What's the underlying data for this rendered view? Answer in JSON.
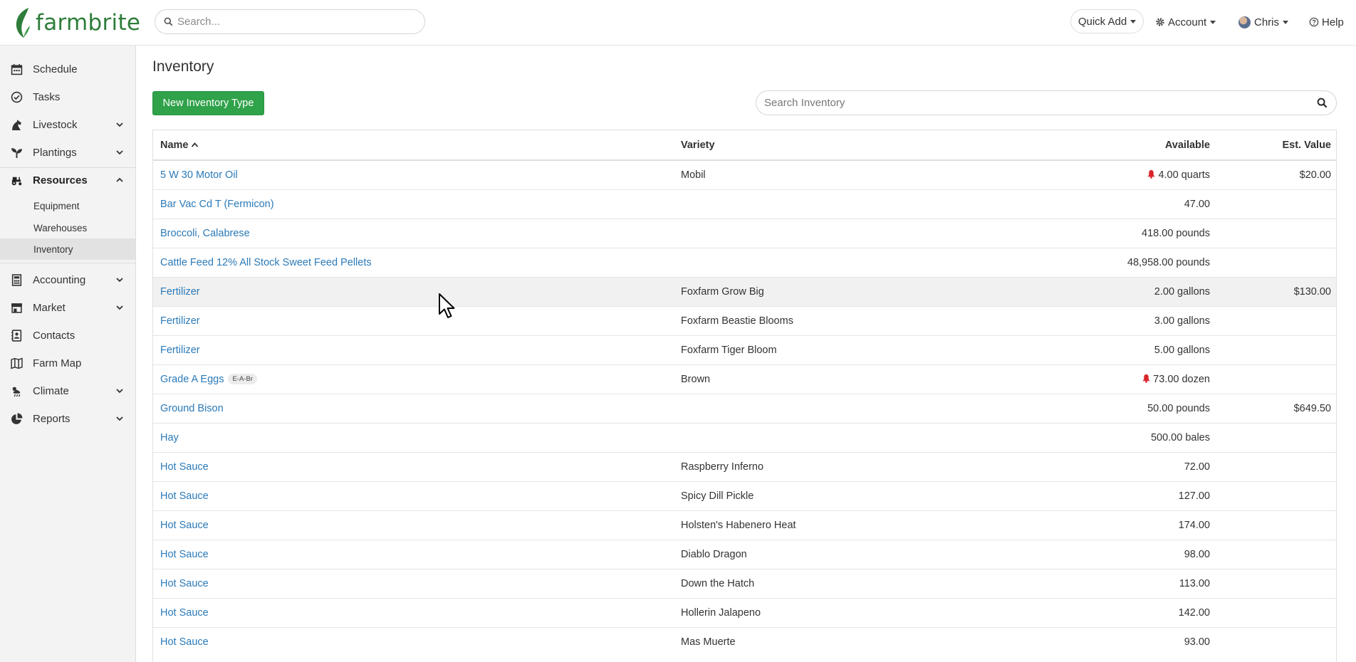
{
  "app": {
    "logo_text": "farmbrite",
    "brand_color": "#2e7d3a",
    "link_color": "#2b7ab8",
    "button_color": "#2fa24a"
  },
  "header": {
    "search_placeholder": "Search...",
    "quick_add_label": "Quick Add",
    "account_label": "Account",
    "user_label": "Chris",
    "help_label": "Help"
  },
  "sidebar": {
    "schedule": "Schedule",
    "tasks": "Tasks",
    "livestock": "Livestock",
    "plantings": "Plantings",
    "resources": "Resources",
    "equipment": "Equipment",
    "warehouses": "Warehouses",
    "inventory": "Inventory",
    "accounting": "Accounting",
    "market": "Market",
    "contacts": "Contacts",
    "farm_map": "Farm Map",
    "climate": "Climate",
    "reports": "Reports"
  },
  "main": {
    "title": "Inventory",
    "new_button": "New Inventory Type",
    "search_placeholder": "Search Inventory",
    "columns": {
      "name": "Name",
      "variety": "Variety",
      "available": "Available",
      "value": "Est. Value"
    },
    "rows": [
      {
        "name": "5 W 30 Motor Oil",
        "variety": "Mobil",
        "available": "4.00 quarts",
        "value": "$20.00",
        "alert": true
      },
      {
        "name": "Bar Vac Cd T (Fermicon)",
        "variety": "",
        "available": "47.00",
        "value": ""
      },
      {
        "name": "Broccoli, Calabrese",
        "variety": "",
        "available": "418.00 pounds",
        "value": ""
      },
      {
        "name": "Cattle Feed 12% All Stock Sweet Feed Pellets",
        "variety": "",
        "available": "48,958.00 pounds",
        "value": ""
      },
      {
        "name": "Fertilizer",
        "variety": "Foxfarm Grow Big",
        "available": "2.00 gallons",
        "value": "$130.00"
      },
      {
        "name": "Fertilizer",
        "variety": "Foxfarm Beastie Blooms",
        "available": "3.00 gallons",
        "value": ""
      },
      {
        "name": "Fertilizer",
        "variety": "Foxfarm Tiger Bloom",
        "available": "5.00 gallons",
        "value": ""
      },
      {
        "name": "Grade A Eggs",
        "tag": "E-A-Br",
        "variety": "Brown",
        "available": "73.00 dozen",
        "value": "",
        "alert": true
      },
      {
        "name": "Ground Bison",
        "variety": "",
        "available": "50.00 pounds",
        "value": "$649.50"
      },
      {
        "name": "Hay",
        "variety": "",
        "available": "500.00 bales",
        "value": ""
      },
      {
        "name": "Hot Sauce",
        "variety": "Raspberry Inferno",
        "available": "72.00",
        "value": ""
      },
      {
        "name": "Hot Sauce",
        "variety": "Spicy Dill Pickle",
        "available": "127.00",
        "value": ""
      },
      {
        "name": "Hot Sauce",
        "variety": "Holsten's Habenero Heat",
        "available": "174.00",
        "value": ""
      },
      {
        "name": "Hot Sauce",
        "variety": "Diablo Dragon",
        "available": "98.00",
        "value": ""
      },
      {
        "name": "Hot Sauce",
        "variety": "Down the Hatch",
        "available": "113.00",
        "value": ""
      },
      {
        "name": "Hot Sauce",
        "variety": "Hollerin Jalapeno",
        "available": "142.00",
        "value": ""
      },
      {
        "name": "Hot Sauce",
        "variety": "Mas Muerte",
        "available": "93.00",
        "value": ""
      }
    ]
  }
}
